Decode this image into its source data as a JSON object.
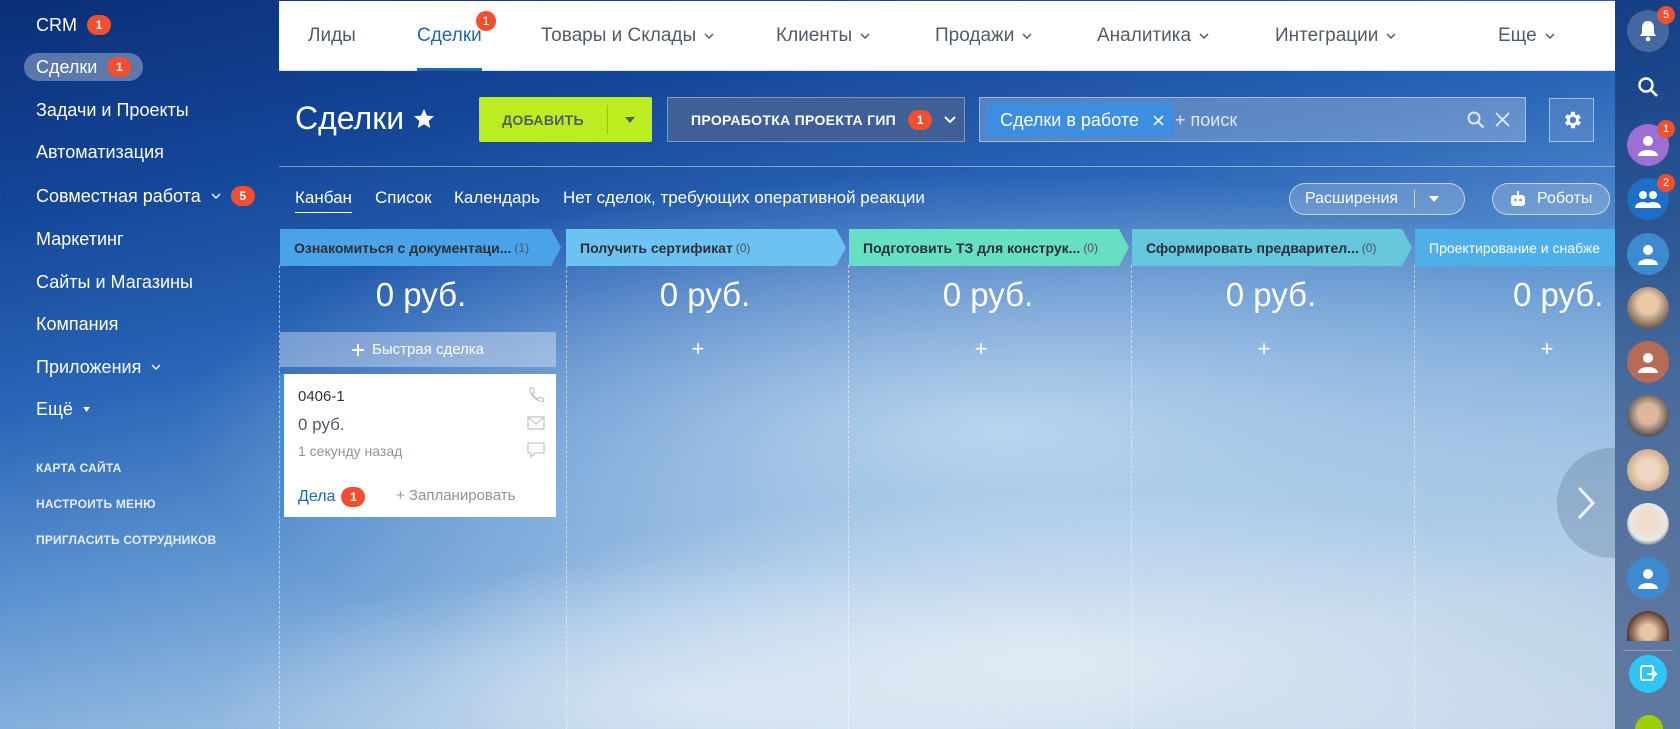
{
  "sidebar": {
    "items": [
      {
        "label": "CRM",
        "badge": "1"
      },
      {
        "label": "Сделки",
        "badge": "1"
      },
      {
        "label": "Задачи и Проекты"
      },
      {
        "label": "Автоматизация"
      },
      {
        "label": "Совместная работа",
        "badge": "5"
      },
      {
        "label": "Маркетинг"
      },
      {
        "label": "Сайты и Магазины"
      },
      {
        "label": "Компания"
      },
      {
        "label": "Приложения"
      },
      {
        "label": "Ещё"
      }
    ],
    "links": [
      "КАРТА САЙТА",
      "НАСТРОИТЬ МЕНЮ",
      "ПРИГЛАСИТЬ СОТРУДНИКОВ"
    ]
  },
  "topnav": {
    "items": [
      {
        "label": "Лиды"
      },
      {
        "label": "Сделки",
        "badge": "1"
      },
      {
        "label": "Товары и Склады"
      },
      {
        "label": "Клиенты"
      },
      {
        "label": "Продажи"
      },
      {
        "label": "Аналитика"
      },
      {
        "label": "Интеграции"
      },
      {
        "label": "Еще"
      }
    ]
  },
  "toolbar": {
    "title": "Сделки",
    "add_label": "ДОБАВИТЬ",
    "category_label": "ПРОРАБОТКА ПРОЕКТА ГИП",
    "category_badge": "1",
    "filter_tag": "Сделки в работе",
    "search_placeholder": "+ поиск"
  },
  "views": {
    "tabs": [
      "Канбан",
      "Список",
      "Календарь"
    ],
    "notice": "Нет сделок, требующих оперативной реакции",
    "extensions_label": "Расширения",
    "robots_label": "Роботы"
  },
  "kanban": {
    "stages": [
      {
        "name": "Ознакомиться с документаци...",
        "count": "(1)",
        "sum": "0 руб.",
        "color": "#4aa3e8"
      },
      {
        "name": "Получить сертификат",
        "count": "(0)",
        "sum": "0 руб.",
        "color": "#6cc3f1"
      },
      {
        "name": "Подготовить ТЗ для конструк...",
        "count": "(0)",
        "sum": "0 руб.",
        "color": "#66dfc2"
      },
      {
        "name": "Сформировать предварител...",
        "count": "(0)",
        "sum": "0 руб.",
        "color": "#65c6dc"
      },
      {
        "name": "Проектирование и снабже",
        "count": "",
        "sum": "0 руб.",
        "color": "#4fb0e9"
      }
    ],
    "add_symbol": "+",
    "quick_deal_label": "Быстрая сделка",
    "card": {
      "title": "0406-1",
      "sum": "0 руб.",
      "time": "1 секунду назад",
      "deals_label": "Дела",
      "deals_badge": "1",
      "plan_label": "+ Запланировать"
    }
  },
  "rightbar": {
    "notifications_badge": "5",
    "avatar_badge_1": "1",
    "group_badge": "2"
  }
}
